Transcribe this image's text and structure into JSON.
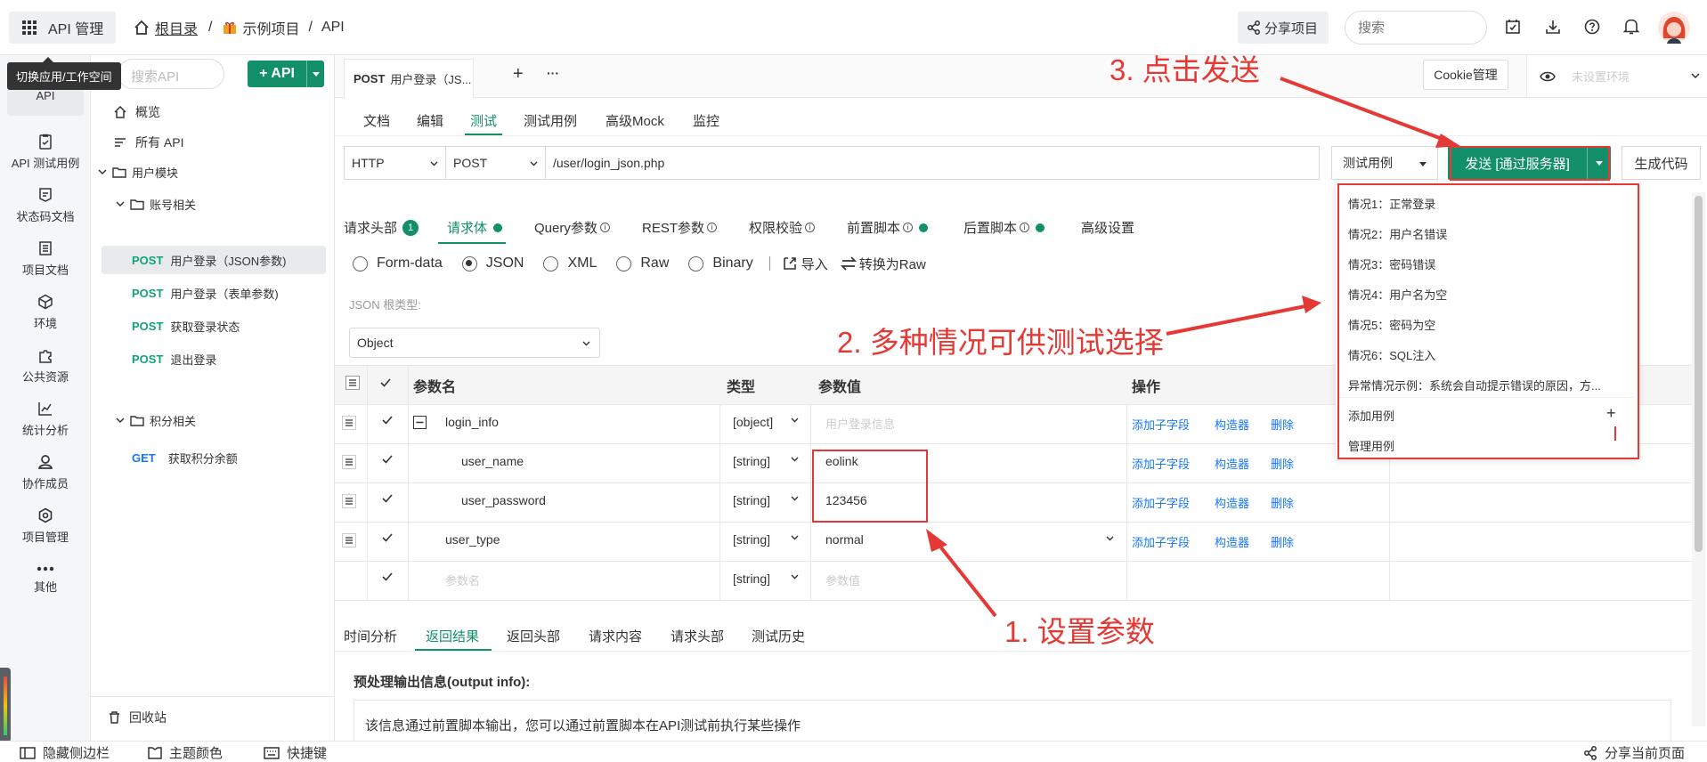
{
  "topbar": {
    "app_label": "API 管理",
    "breadcrumb_root": "根目录",
    "breadcrumb_sep1": "/",
    "breadcrumb_project": "示例项目",
    "breadcrumb_sep2": "/",
    "breadcrumb_current": "API",
    "share_label": "分享项目",
    "search_placeholder": "搜索",
    "tooltip": "切换应用/工作空间"
  },
  "rail": {
    "items": [
      {
        "label": "API",
        "icon": "api-icon"
      },
      {
        "label": "API 测试用例",
        "icon": "testcase-icon"
      },
      {
        "label": "状态码文档",
        "icon": "statuscode-icon"
      },
      {
        "label": "项目文档",
        "icon": "doc-icon"
      },
      {
        "label": "环境",
        "icon": "environment-icon"
      },
      {
        "label": "公共资源",
        "icon": "puzzle-icon"
      },
      {
        "label": "统计分析",
        "icon": "chart-icon"
      },
      {
        "label": "协作成员",
        "icon": "member-icon"
      },
      {
        "label": "项目管理",
        "icon": "gear-icon"
      },
      {
        "label": "其他",
        "icon": "more-icon"
      }
    ]
  },
  "tree": {
    "search_placeholder": "搜索API",
    "add_api_label": "+ API",
    "overview": "概览",
    "all_api": "所有 API",
    "group_user": "用户模块",
    "group_account": "账号相关",
    "items_account": [
      {
        "method": "POST",
        "name": "用户登录（JSON参数)"
      },
      {
        "method": "POST",
        "name": "用户登录（表单参数)"
      },
      {
        "method": "POST",
        "name": "获取登录状态"
      },
      {
        "method": "POST",
        "name": "退出登录"
      }
    ],
    "group_points": "积分相关",
    "items_points": [
      {
        "method": "GET",
        "name": "获取积分余额"
      }
    ],
    "recycle": "回收站"
  },
  "tabbar": {
    "active_method": "POST",
    "active_name": "用户登录（JS...",
    "add": "+",
    "more": "···",
    "cookie_label": "Cookie管理",
    "env_placeholder": "未设置环境"
  },
  "subtabs": [
    "文档",
    "编辑",
    "测试",
    "测试用例",
    "高级Mock",
    "监控"
  ],
  "request": {
    "protocol": "HTTP",
    "method": "POST",
    "url": "/user/login_json.php",
    "testcase_label": "测试用例",
    "send_label": "发送 [通过服务器]",
    "gen_code_label": "生成代码"
  },
  "param_tabs": {
    "headers": "请求头部",
    "headers_count": "1",
    "body": "请求体",
    "query": "Query参数",
    "rest": "REST参数",
    "auth": "权限校验",
    "pre_script": "前置脚本",
    "post_script": "后置脚本",
    "advanced": "高级设置",
    "info_glyph": "i"
  },
  "body_types": [
    "Form-data",
    "JSON",
    "XML",
    "Raw",
    "Binary"
  ],
  "body_actions": {
    "import": "导入",
    "convert": "转换为Raw"
  },
  "json_root": {
    "label": "JSON 根类型:",
    "value": "Object"
  },
  "table": {
    "headers": {
      "name": "参数名",
      "type": "类型",
      "value": "参数值",
      "ops": "操作"
    },
    "rows": [
      {
        "name": "login_info",
        "type": "[object]",
        "value": "用户登录信息",
        "value_placeholder": true
      },
      {
        "name": "user_name",
        "type": "[string]",
        "value": "eolink",
        "value_placeholder": false
      },
      {
        "name": "user_password",
        "type": "[string]",
        "value": "123456",
        "value_placeholder": false
      },
      {
        "name": "user_type",
        "type": "[string]",
        "value": "normal",
        "value_placeholder": false
      },
      {
        "name": "参数名",
        "type": "[string]",
        "value": "参数值",
        "value_placeholder": true
      }
    ],
    "op_add_child": "添加子字段",
    "op_builder": "构造器",
    "op_delete": "删除"
  },
  "dropdown": {
    "items": [
      "情况1：正常登录",
      "情况2：用户名错误",
      "情况3：密码错误",
      "情况4：用户名为空",
      "情况5：密码为空",
      "情况6：SQL注入",
      "异常情况示例：系统会自动提示错误的原因，方..."
    ],
    "add_case": "添加用例",
    "add_glyph": "+",
    "manage_case": "管理用例"
  },
  "result_tabs": [
    "时间分析",
    "返回结果",
    "返回头部",
    "请求内容",
    "请求头部",
    "测试历史"
  ],
  "output": {
    "title": "预处理输出信息(output info):",
    "text": "该信息通过前置脚本输出，您可以通过前置脚本在API测试前执行某些操作"
  },
  "bottombar": {
    "hide_sidebar": "隐藏侧边栏",
    "theme": "主题颜色",
    "shortcuts": "快捷键",
    "share_page": "分享当前页面"
  },
  "annotations": {
    "step1": "1. 设置参数",
    "step2": "2. 多种情况可供测试选择",
    "step3": "3. 点击发送"
  },
  "colors": {
    "accent": "#13906a",
    "annotation": "#e53935",
    "link": "#1677ff"
  }
}
